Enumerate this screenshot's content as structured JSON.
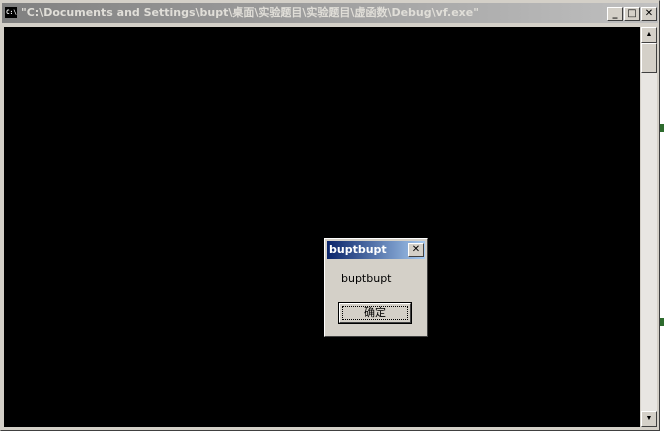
{
  "console": {
    "title": "\"C:\\Documents and Settings\\bupt\\桌面\\实验题目\\实验题目\\虚函数\\Debug\\vf.exe\"",
    "icon": "console-app-icon",
    "icon_glyph": "C:\\",
    "buttons": {
      "minimize": "_",
      "maximize": "□",
      "close": "✕"
    },
    "scrollbar": {
      "up_arrow": "▲",
      "down_arrow": "▼"
    },
    "background_color": "#000000"
  },
  "message_box": {
    "title": "buptbupt",
    "message": "buptbupt",
    "ok_label": "确定",
    "close_glyph": "✕",
    "title_color_start": "#0a246a",
    "title_color_end": "#a6caf0"
  }
}
